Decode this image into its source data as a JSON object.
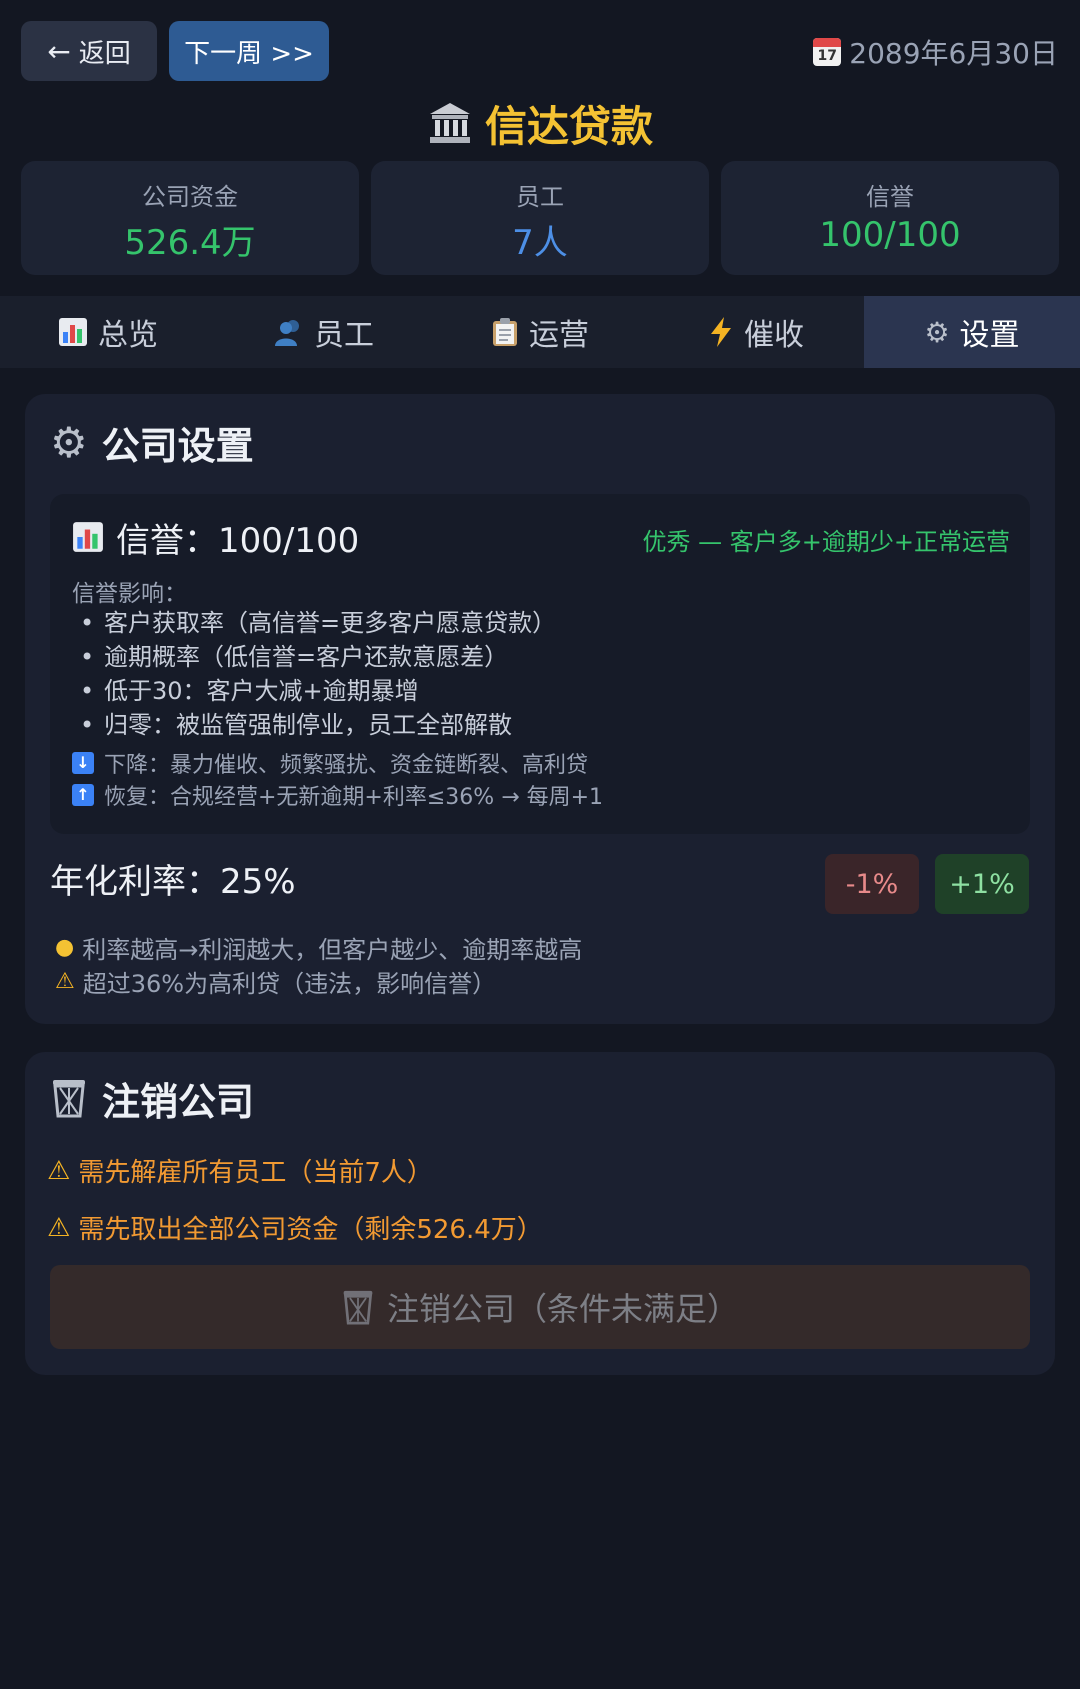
{
  "topbar": {
    "back_label": "返回",
    "next_label": "下一周 >>",
    "date": "2089年6月30日"
  },
  "title": "信达贷款",
  "stats": {
    "funds": {
      "label": "公司资金",
      "value": "526.4万"
    },
    "staff": {
      "label": "员工",
      "value": "7人"
    },
    "reputation": {
      "label": "信誉",
      "value": "100/100"
    }
  },
  "tabs": [
    {
      "label": "总览",
      "icon": "bar-chart-icon"
    },
    {
      "label": "员工",
      "icon": "people-icon"
    },
    {
      "label": "运营",
      "icon": "clipboard-icon"
    },
    {
      "label": "催收",
      "icon": "lightning-icon"
    },
    {
      "label": "设置",
      "icon": "gear-icon",
      "active": true
    }
  ],
  "settings": {
    "title": "公司设置",
    "reputation": {
      "heading": "信誉：100/100",
      "status": "优秀 — 客户多+逾期少+正常运营",
      "impact_title": "信誉影响：",
      "impacts": [
        "客户获取率（高信誉=更多客户愿意贷款）",
        "逾期概率（低信誉=客户还款意愿差）",
        "低于30：客户大减+逾期暴增",
        "归零：被监管强制停业，员工全部解散"
      ],
      "decrease_note": "下降：暴力催收、频繁骚扰、资金链断裂、高利贷",
      "recover_note": "恢复：合规经营+无新逾期+利率≤36% → 每周+1"
    },
    "rate": {
      "label": "年化利率：25%",
      "minus_label": "-1%",
      "plus_label": "+1%",
      "tip_1": "利率越高→利润越大，但客户越少、逾期率越高",
      "tip_2": "超过36%为高利贷（违法，影响信誉）"
    }
  },
  "close_company": {
    "title": "注销公司",
    "req_1": "需先解雇所有员工（当前7人）",
    "req_2": "需先取出全部公司资金（剩余526.4万）",
    "button_label": "注销公司（条件未满足）"
  },
  "colors": {
    "background": "#131722",
    "accent_gold": "#f4c233",
    "positive_green": "#35c46c",
    "staff_blue": "#4d8fe6",
    "warning_orange": "#f29a32"
  }
}
